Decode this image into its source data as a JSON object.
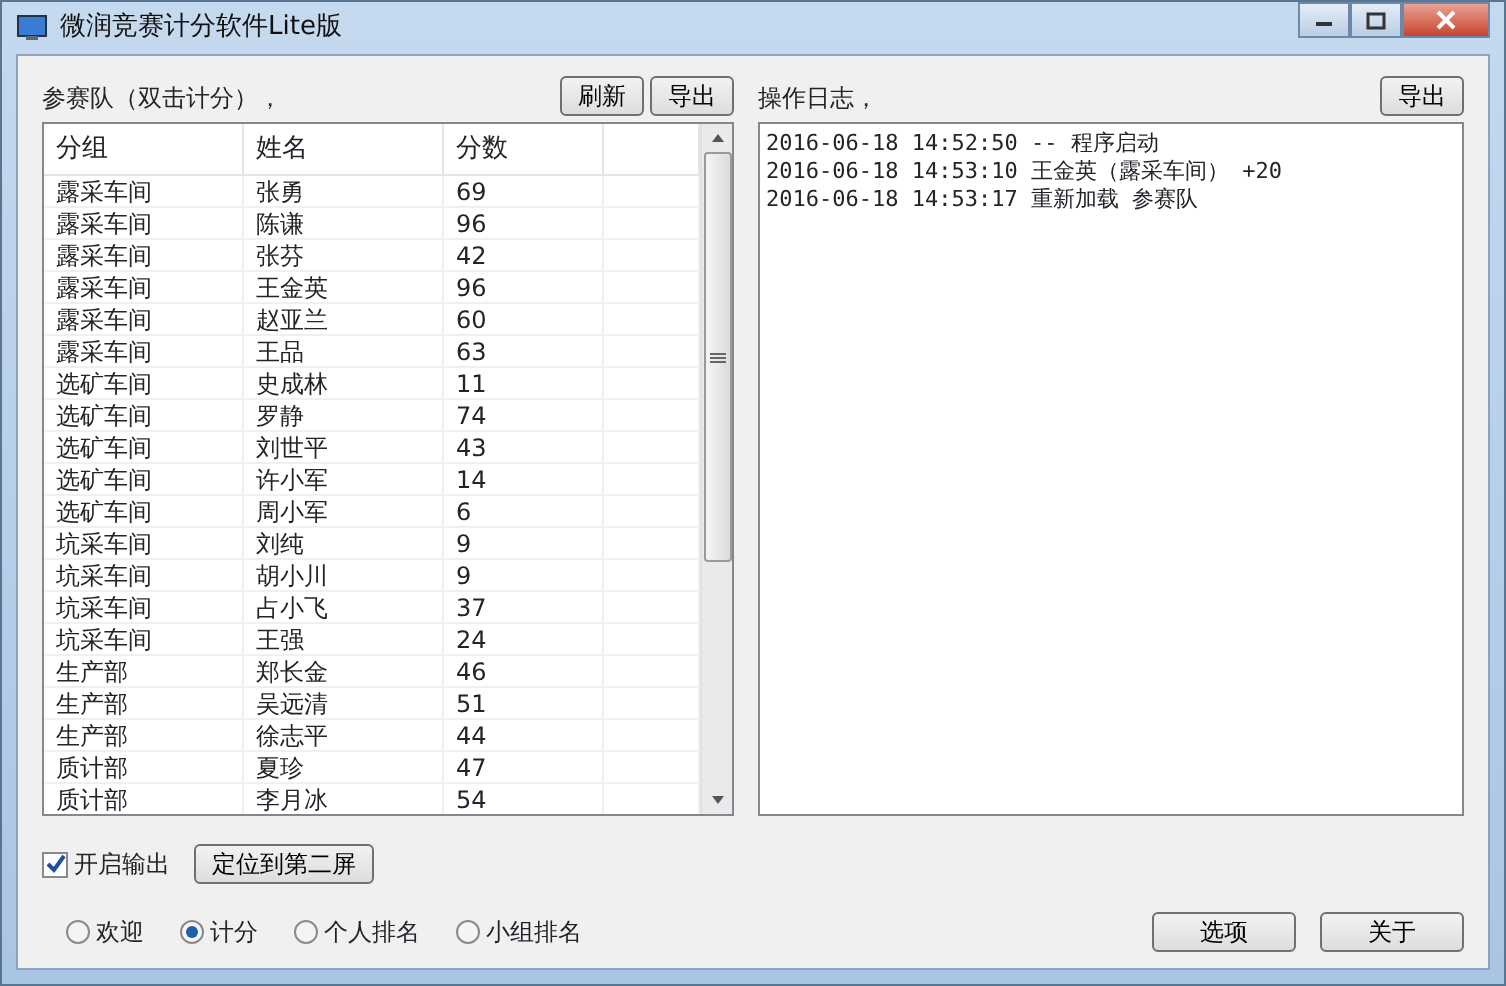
{
  "window": {
    "title": "微润竞赛计分软件Lite版"
  },
  "teams": {
    "label": "参赛队（双击计分），",
    "buttons": [
      "刷新",
      "导出"
    ],
    "columns": [
      "分组",
      "姓名",
      "分数"
    ],
    "rows": [
      [
        "露采车间",
        "张勇",
        "69"
      ],
      [
        "露采车间",
        "陈谦",
        "96"
      ],
      [
        "露采车间",
        "张芬",
        "42"
      ],
      [
        "露采车间",
        "王金英",
        "96"
      ],
      [
        "露采车间",
        "赵亚兰",
        "60"
      ],
      [
        "露采车间",
        "王品",
        "63"
      ],
      [
        "选矿车间",
        "史成林",
        "11"
      ],
      [
        "选矿车间",
        "罗静",
        "74"
      ],
      [
        "选矿车间",
        "刘世平",
        "43"
      ],
      [
        "选矿车间",
        "许小军",
        "14"
      ],
      [
        "选矿车间",
        "周小军",
        "6"
      ],
      [
        "坑采车间",
        "刘纯",
        "9"
      ],
      [
        "坑采车间",
        "胡小川",
        "9"
      ],
      [
        "坑采车间",
        "占小飞",
        "37"
      ],
      [
        "坑采车间",
        "王强",
        "24"
      ],
      [
        "生产部",
        "郑长金",
        "46"
      ],
      [
        "生产部",
        "吴远清",
        "51"
      ],
      [
        "生产部",
        "徐志平",
        "44"
      ],
      [
        "质计部",
        "夏珍",
        "47"
      ],
      [
        "质计部",
        "李月冰",
        "54"
      ]
    ]
  },
  "log": {
    "label": "操作日志，",
    "button": "导出",
    "lines": [
      "2016-06-18 14:52:50 -- 程序启动",
      "2016-06-18 14:53:10 王金英（露采车间） +20",
      "2016-06-18 14:53:17 重新加载 参赛队"
    ]
  },
  "output": {
    "label": "开启输出",
    "checked": true
  },
  "locate_button": "定位到第二屏",
  "views": [
    {
      "label": "欢迎",
      "selected": false
    },
    {
      "label": "计分",
      "selected": true
    },
    {
      "label": "个人排名",
      "selected": false
    },
    {
      "label": "小组排名",
      "selected": false
    }
  ],
  "buttons": [
    "选项",
    "关于"
  ]
}
